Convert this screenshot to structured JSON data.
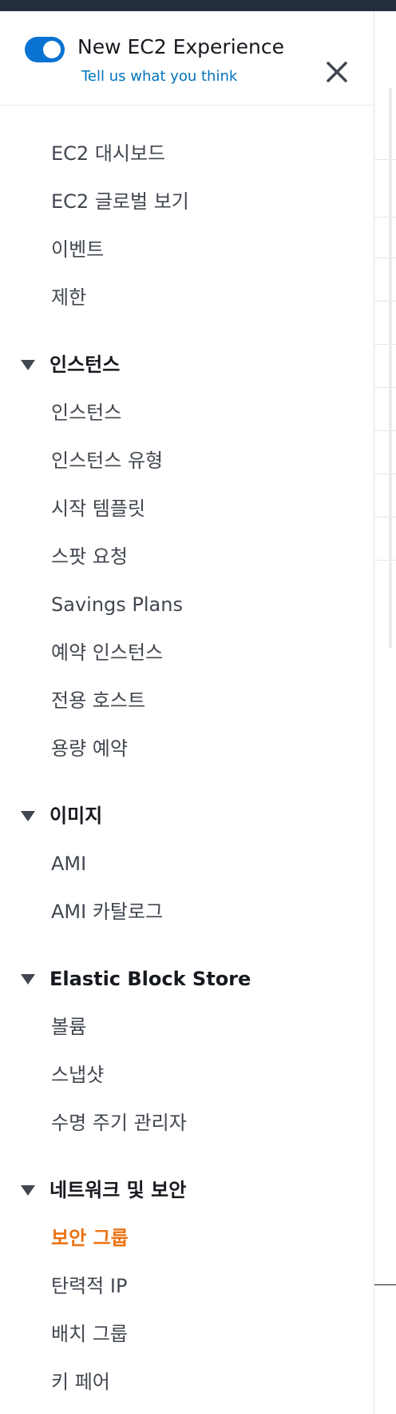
{
  "header": {
    "toggle_state": "on",
    "title": "New EC2 Experience",
    "feedback_link": "Tell us what you think",
    "close_icon": "close-icon"
  },
  "nav": {
    "top_items": [
      "EC2 대시보드",
      "EC2 글로벌 보기",
      "이벤트",
      "제한"
    ],
    "sections": [
      {
        "title": "인스턴스",
        "items": [
          "인스턴스",
          "인스턴스 유형",
          "시작 템플릿",
          "스팟 요청",
          "Savings Plans",
          "예약 인스턴스",
          "전용 호스트",
          "용량 예약"
        ]
      },
      {
        "title": "이미지",
        "items": [
          "AMI",
          "AMI 카탈로그"
        ]
      },
      {
        "title": "Elastic Block Store",
        "items": [
          "볼륨",
          "스냅샷",
          "수명 주기 관리자"
        ]
      },
      {
        "title": "네트워크 및 보안",
        "items": [
          "보안 그룹",
          "탄력적 IP",
          "배치 그룹",
          "키 페어"
        ]
      }
    ],
    "active_item": "보안 그룹"
  },
  "colors": {
    "toggle": "#0972d3",
    "link": "#0073bb",
    "active": "#ec7211",
    "text": "#414750",
    "topbar": "#232f3e"
  }
}
